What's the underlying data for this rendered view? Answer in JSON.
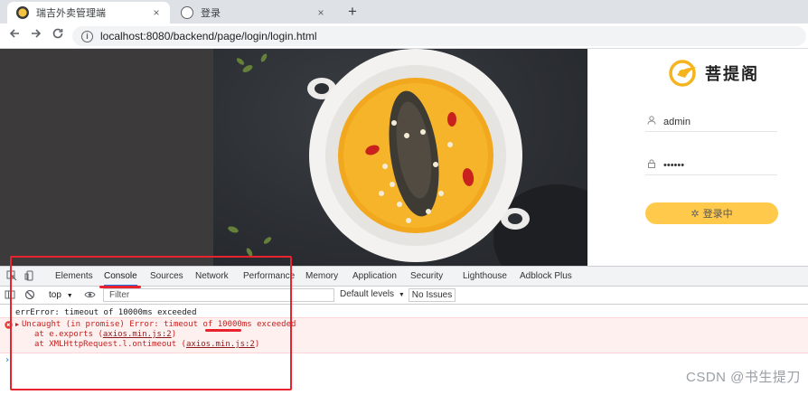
{
  "browser": {
    "tabs": [
      {
        "title": "瑞吉外卖管理端",
        "active": true
      },
      {
        "title": "登录",
        "active": false
      }
    ],
    "close_glyph": "×",
    "new_tab_glyph": "+",
    "address": "localhost:8080/backend/page/login/login.html",
    "icons": {
      "back": "arrow-left-icon",
      "forward": "arrow-right-icon",
      "reload": "reload-icon",
      "info": "info-icon"
    }
  },
  "login": {
    "brand_name": "菩提阁",
    "username": "admin",
    "password": "••••••",
    "button_label": "登录中",
    "button_icon": "loading-spinner-icon",
    "button_color": "#ffc94b"
  },
  "devtools": {
    "tabs": [
      "Elements",
      "Console",
      "Sources",
      "Network",
      "Performance",
      "Memory",
      "Application",
      "Security",
      "Lighthouse",
      "Adblock Plus"
    ],
    "active_tab": "Console",
    "context": "top",
    "filter_placeholder": "Filter",
    "levels": "Default levels",
    "issues": "No Issues",
    "log": "errError: timeout of 10000ms exceeded",
    "error": {
      "message": "Uncaught (in promise) Error: timeout of 10000ms exceeded",
      "frame1_prefix": "at e.exports (",
      "frame1_link": "axios.min.js:2",
      "frame2_prefix": "at XMLHttpRequest.l.ontimeout (",
      "frame2_link": "axios.min.js:2",
      "frame_suffix": ")"
    },
    "prompt": "›"
  },
  "watermark": "CSDN @书生提刀",
  "colors": {
    "annotation_red": "#e8232d",
    "devtools_active_underline": "#1a73e8",
    "error_text": "#c5221f"
  }
}
